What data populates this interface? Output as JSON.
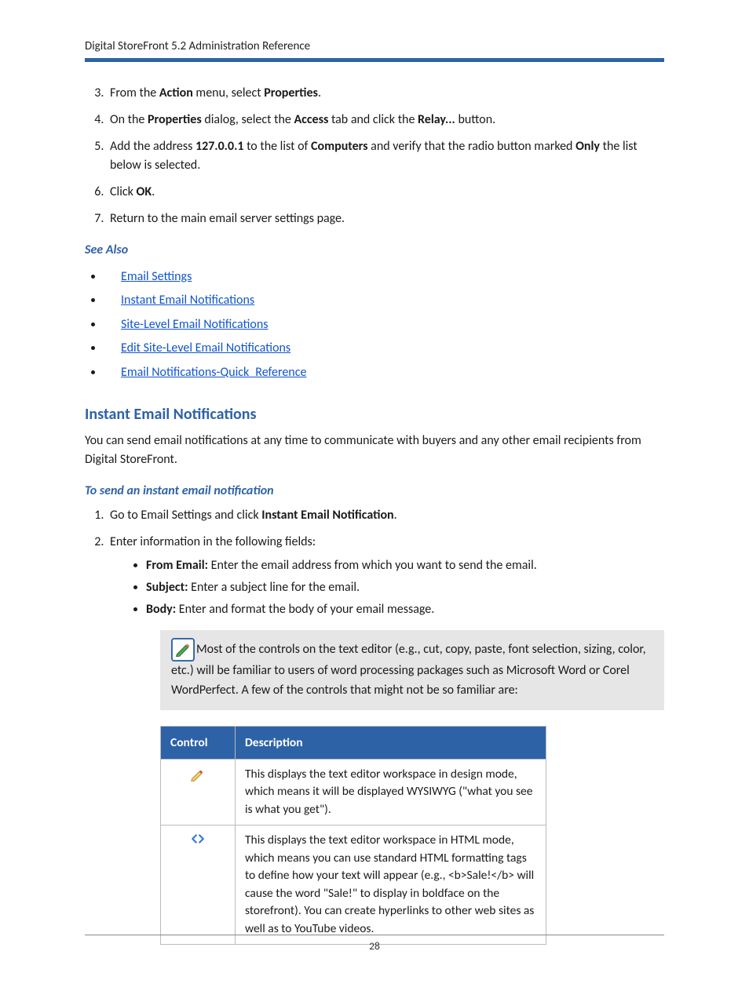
{
  "header": {
    "title": "Digital StoreFront 5.2 Administration Reference"
  },
  "steps_upper": [
    {
      "n": "3",
      "pre": "From the ",
      "b1": "Action",
      "mid": " menu, select ",
      "b2": "Properties",
      "post": "."
    },
    {
      "n": "4",
      "pre": "On the ",
      "b1": "Properties",
      "mid": " dialog, select the ",
      "b2": "Access",
      "mid2": " tab and click the ",
      "b3": "Relay...",
      "post": " button."
    },
    {
      "n": "5",
      "pre": "Add the address ",
      "b1": "127.0.0.1",
      "mid": " to the list of ",
      "b2": "Computers",
      "mid2": " and verify that the radio button marked ",
      "b3": "Only",
      "post": " the list below is selected."
    },
    {
      "n": "6",
      "pre": "Click ",
      "b1": "OK",
      "post": "."
    },
    {
      "n": "7",
      "pre": "Return to the main email server settings page."
    }
  ],
  "see_also": {
    "heading": "See Also",
    "links": [
      "Email Settings",
      "Instant Email Notifications",
      "Site-Level Email Notifications",
      "Edit Site-Level Email Notifications",
      "Email Notifications-Quick_Reference"
    ]
  },
  "section": {
    "heading": "Instant Email Notifications",
    "intro": "You can send email notifications at any time to communicate with buyers and any other email recipients from Digital StoreFront."
  },
  "subsection": {
    "heading": "To send an instant email notification",
    "steps": [
      {
        "pre": "Go to Email Settings and click ",
        "b1": "Instant Email Notification",
        "post": "."
      },
      {
        "pre": "Enter information in the following fields:"
      }
    ],
    "fields": [
      {
        "label": "From Email:",
        "text": " Enter the email address from which you want to send the email."
      },
      {
        "label": "Subject:",
        "text": " Enter a subject line for the email."
      },
      {
        "label": "Body:",
        "text": " Enter and format the body of your email message."
      }
    ]
  },
  "note": "Most of the controls on the text editor (e.g., cut, copy, paste, font selection, sizing, color, etc.) will be familiar to users of word processing packages such as Microsoft Word or Corel WordPerfect. A few of the controls that might not be so familiar are:",
  "table": {
    "headers": {
      "c1": "Control",
      "c2": "Description"
    },
    "rows": [
      {
        "icon": "pencil",
        "desc": "This displays the text editor workspace in design mode, which means it will be displayed WYSIWYG (\"what you see is what you get\")."
      },
      {
        "icon": "code",
        "desc": "This displays the text editor workspace in HTML mode, which means you can use standard HTML formatting tags to define how your text will appear (e.g., <b>Sale!</b> will cause the word \"Sale!\" to display in boldface on the storefront). You can create hyperlinks to other web sites as well as to YouTube videos."
      }
    ]
  },
  "page_number": "28"
}
